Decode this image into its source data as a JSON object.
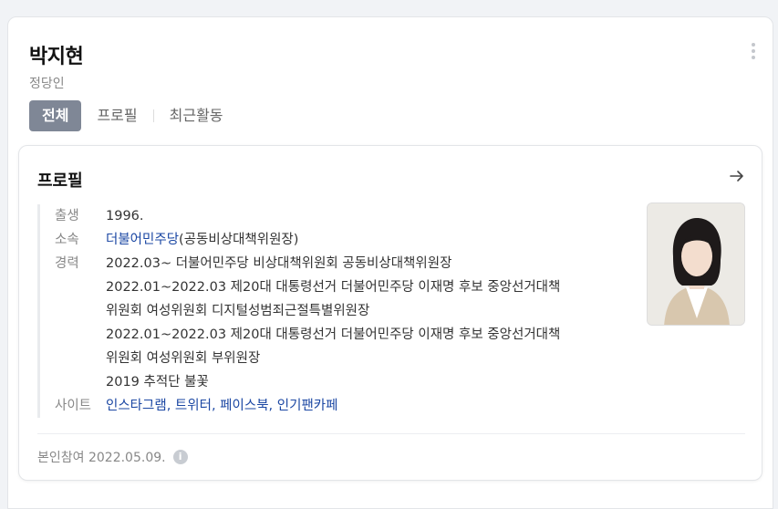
{
  "header": {
    "name": "박지현",
    "subtitle": "정당인"
  },
  "tabs": [
    {
      "label": "전체",
      "active": true
    },
    {
      "label": "프로필",
      "active": false
    },
    {
      "label": "최근활동",
      "active": false
    }
  ],
  "profile": {
    "title": "프로필",
    "birth_label": "출생",
    "birth_value": "1996.",
    "affiliation_label": "소속",
    "affiliation_party": "더불어민주당",
    "affiliation_role": "(공동비상대책위원장)",
    "career_label": "경력",
    "career_lines": [
      "2022.03~ 더불어민주당 비상대책위원회 공동비상대책위원장",
      "2022.01~2022.03 제20대 대통령선거 더불어민주당 이재명 후보 중앙선거대책",
      "위원회 여성위원회 디지털성범죄근절특별위원장",
      "2022.01~2022.03 제20대 대통령선거 더불어민주당 이재명 후보 중앙선거대책",
      "위원회 여성위원회 부위원장",
      "2019 추적단 불꽃"
    ],
    "site_label": "사이트",
    "sites": [
      "인스타그램",
      "트위터",
      "페이스북",
      "인기팬카페"
    ],
    "site_separator": ", ",
    "footer_text": "본인참여 2022.05.09."
  },
  "colors": {
    "link": "#1b47a3",
    "active_tab_bg": "#7f8796"
  },
  "icons": {
    "more": "more-vertical-icon",
    "arrow": "arrow-right-icon",
    "info": "info-icon"
  }
}
